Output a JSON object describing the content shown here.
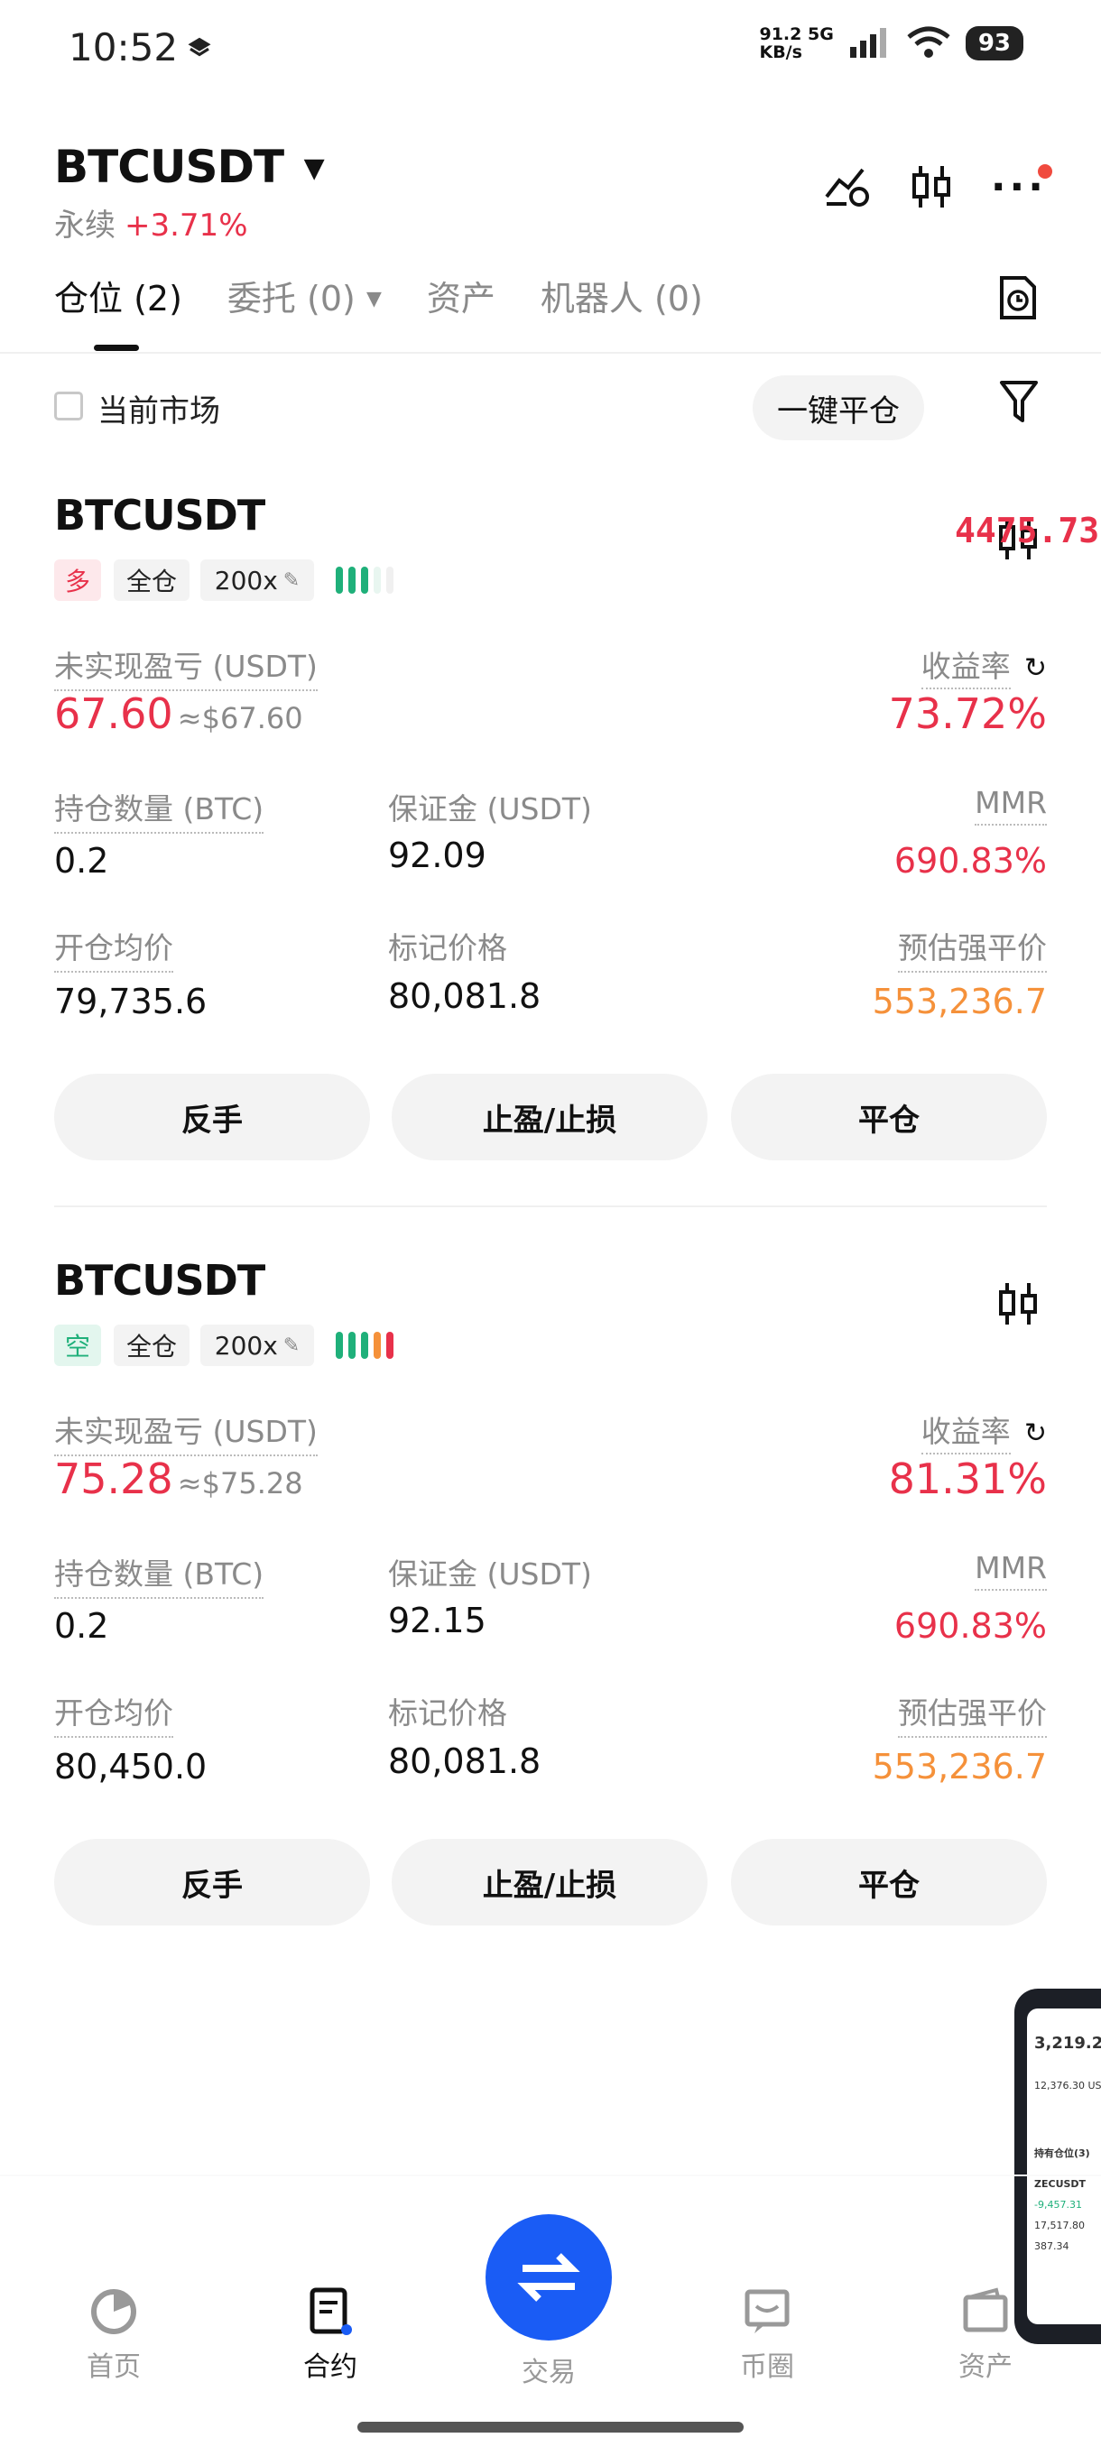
{
  "status_bar": {
    "time": "10:52",
    "net_speed": "91.2",
    "net_unit": "KB/s",
    "net_type": "5G",
    "battery": "93"
  },
  "header": {
    "pair": "BTCUSDT",
    "type": "永续",
    "change": "+3.71%",
    "icons": [
      "price-alert-icon",
      "candlestick-icon",
      "more-icon"
    ]
  },
  "tabs": [
    {
      "label": "仓位 (2)",
      "active": true
    },
    {
      "label": "委托 (0)",
      "active": false,
      "dropdown": true
    },
    {
      "label": "资产",
      "active": false
    },
    {
      "label": "机器人 (0)",
      "active": false
    }
  ],
  "filter": {
    "current_market_label": "当前市场",
    "close_all_label": "一键平仓"
  },
  "overlay_text": "4475.73",
  "positions": [
    {
      "symbol": "BTCUSDT",
      "side": "多",
      "side_color": "#e8314a",
      "side_bg": "#fde8eb",
      "margin_mode": "全仓",
      "leverage": "200x",
      "risk_bars": [
        "#1fb07a",
        "#1fb07a",
        "#1fb07a",
        "#e8f6f0",
        "#f0f0f0"
      ],
      "pnl_label": "未实现盈亏 (USDT)",
      "pnl": "67.60",
      "pnl_usd": "≈$67.60",
      "roe_label": "收益率",
      "roe": "73.72%",
      "size_label": "持仓数量 (BTC)",
      "size": "0.2",
      "margin_label": "保证金 (USDT)",
      "margin": "92.09",
      "mmr_label": "MMR",
      "mmr": "690.83%",
      "entry_label": "开仓均价",
      "entry": "79,735.6",
      "mark_label": "标记价格",
      "mark": "80,081.8",
      "liq_label": "预估强平价",
      "liq": "553,236.7",
      "buttons": [
        "反手",
        "止盈/止损",
        "平仓"
      ]
    },
    {
      "symbol": "BTCUSDT",
      "side": "空",
      "side_color": "#1fb07a",
      "side_bg": "#e3f6ee",
      "margin_mode": "全仓",
      "leverage": "200x",
      "risk_bars": [
        "#1fb07a",
        "#1fb07a",
        "#1fb07a",
        "#f5913a",
        "#e8314a"
      ],
      "pnl_label": "未实现盈亏 (USDT)",
      "pnl": "75.28",
      "pnl_usd": "≈$75.28",
      "roe_label": "收益率",
      "roe": "81.31%",
      "size_label": "持仓数量 (BTC)",
      "size": "0.2",
      "margin_label": "保证金 (USDT)",
      "margin": "92.15",
      "mmr_label": "MMR",
      "mmr": "690.83%",
      "entry_label": "开仓均价",
      "entry": "80,450.0",
      "mark_label": "标记价格",
      "mark": "80,081.8",
      "liq_label": "预估强平价",
      "liq": "553,236.7",
      "buttons": [
        "反手",
        "止盈/止损",
        "平仓"
      ]
    }
  ],
  "bottom_nav": [
    {
      "label": "首页",
      "icon": "home-icon"
    },
    {
      "label": "合约",
      "icon": "contract-icon",
      "active": true
    },
    {
      "label": "交易",
      "icon": "swap-icon"
    },
    {
      "label": "币圈",
      "icon": "community-icon"
    },
    {
      "label": "资产",
      "icon": "wallet-icon"
    }
  ],
  "thumbnail": {
    "total": "3,219.2",
    "line1": "12,376.30 US",
    "section": "持有仓位(3)",
    "symbol": "ZECUSDT",
    "pnl": "-9,457.31",
    "v1": "17,517.80",
    "v2": "387.34"
  }
}
